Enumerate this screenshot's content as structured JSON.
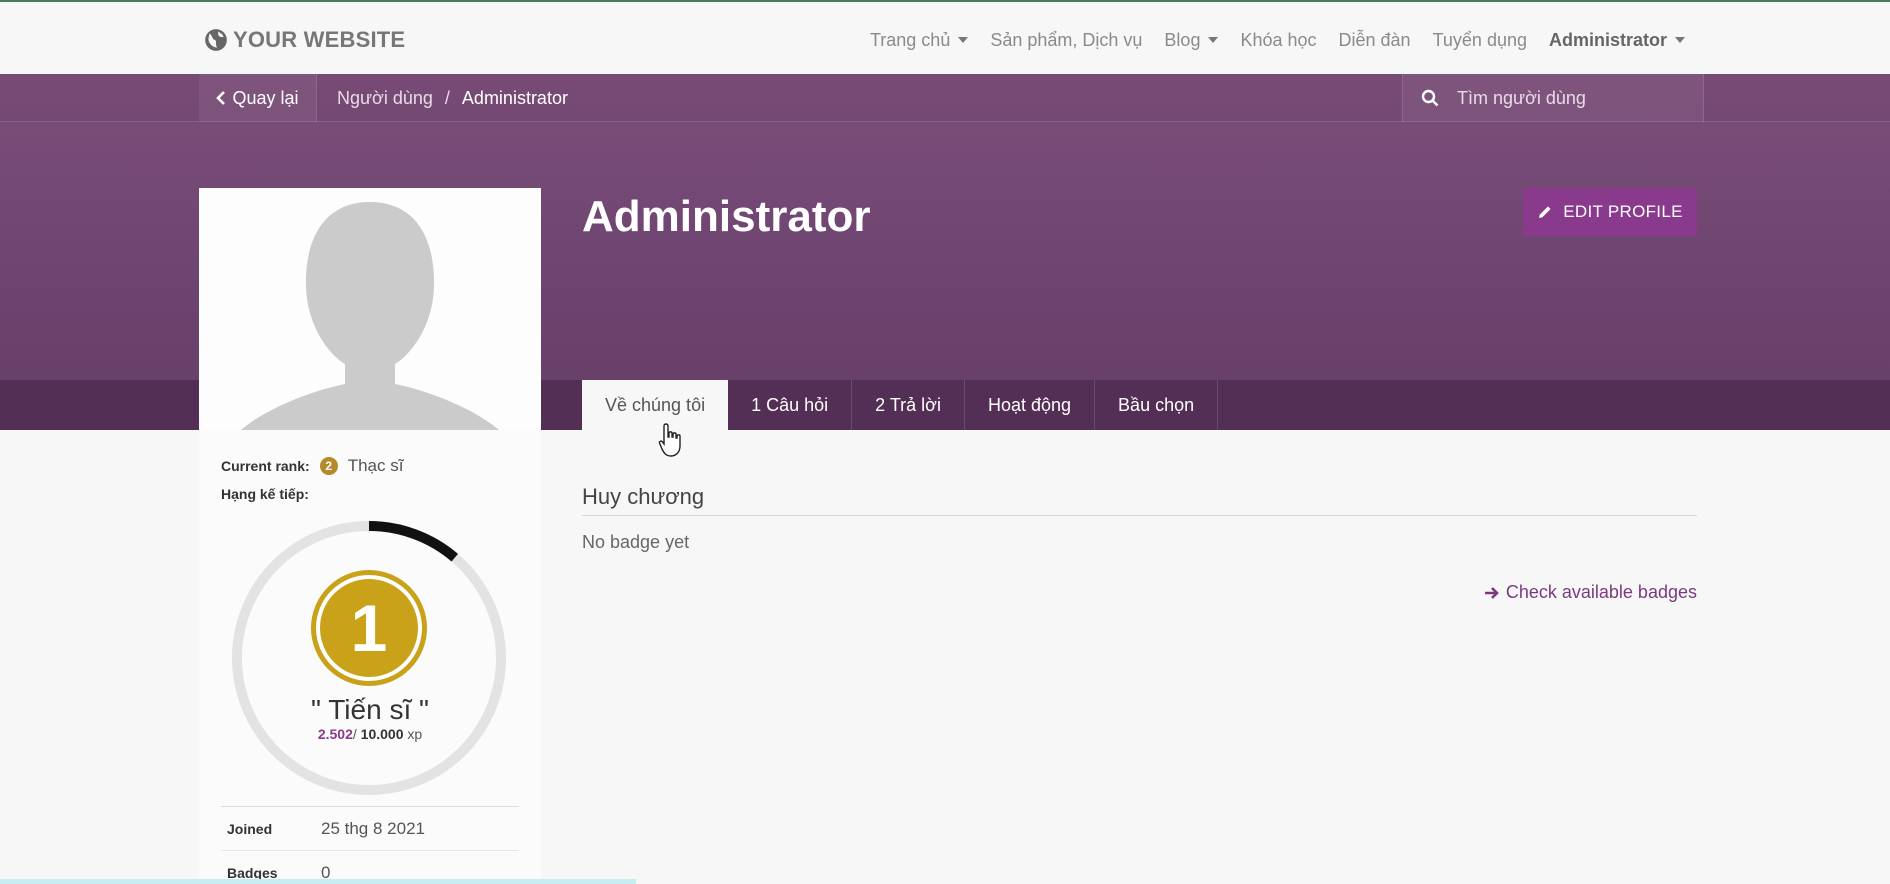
{
  "nav": {
    "brand": "YOUR WEBSITE",
    "items": [
      {
        "label": "Trang chủ",
        "dropdown": true
      },
      {
        "label": "Sản phẩm, Dịch vụ",
        "dropdown": false
      },
      {
        "label": "Blog",
        "dropdown": true
      },
      {
        "label": "Khóa học",
        "dropdown": false
      },
      {
        "label": "Diễn đàn",
        "dropdown": false
      },
      {
        "label": "Tuyển dụng",
        "dropdown": false
      }
    ],
    "user": "Administrator"
  },
  "subbar": {
    "back": "Quay lại",
    "breadcrumb": [
      "Người dùng",
      "/",
      "Administrator"
    ],
    "search_placeholder": "Tìm người dùng"
  },
  "profile": {
    "name": "Administrator",
    "edit_label": "EDIT PROFILE"
  },
  "tabs": [
    "Về chúng tôi",
    "1 Câu hỏi",
    "2 Trả lời",
    "Hoạt động",
    "Bầu chọn"
  ],
  "sidebar": {
    "current_rank_label": "Current rank:",
    "current_rank_num": "2",
    "current_rank": "Thạc sĩ",
    "next_rank_label": "Hạng kế tiếp:",
    "next_rank_num": "1",
    "next_rank_name": "\" Tiến sĩ \"",
    "xp_current": "2.502",
    "xp_sep": "/",
    "xp_total": "10.000",
    "xp_unit": "xp",
    "progress": 0.25,
    "joined_label": "Joined",
    "joined_value": "25 thg 8 2021",
    "badges_label": "Badges",
    "badges_value": "0"
  },
  "main": {
    "section_title": "Huy chương",
    "empty_text": "No badge yet",
    "link": "Check available badges"
  },
  "colors": {
    "purple": "#6e4470",
    "accent": "#8a3a8c",
    "gold": "#c9a21a"
  }
}
